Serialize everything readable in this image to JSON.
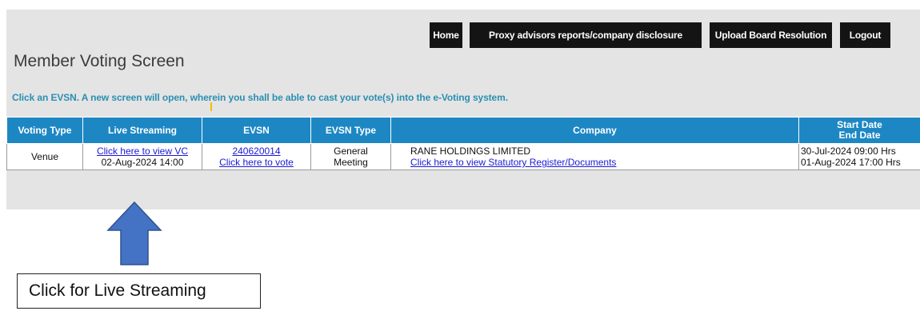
{
  "nav": {
    "home": "Home",
    "proxy": "Proxy advisors reports/company disclosure",
    "upload": "Upload Board Resolution",
    "logout": "Logout"
  },
  "page": {
    "title": "Member Voting Screen",
    "instruction": "Click an EVSN. A new screen will open, wherein you shall be able to cast your vote(s) into the e-Voting system."
  },
  "table": {
    "headers": {
      "voting_type": "Voting Type",
      "live_streaming": "Live Streaming",
      "evsn": "EVSN",
      "evsn_type": "EVSN Type",
      "company": "Company",
      "start_date": "Start Date",
      "end_date": "End Date"
    },
    "rows": [
      {
        "voting_type": "Venue",
        "live_link": "Click here to view VC",
        "live_datetime": "02-Aug-2024 14:00",
        "evsn": "240620014",
        "vote_link": "Click here to vote",
        "evsn_type_1": "General",
        "evsn_type_2": "Meeting",
        "company_name": "RANE HOLDINGS LIMITED",
        "company_link": "Click here to view Statutory Register/Documents",
        "start": "30-Jul-2024 09:00 Hrs",
        "end": "01-Aug-2024 17:00 Hrs"
      }
    ]
  },
  "annotation": {
    "callout": "Click for Live Streaming",
    "arrow_color": "#4472c4"
  },
  "colors": {
    "header_bg": "#1d87c4",
    "nav_bg": "#141414",
    "instruction": "#2a8fb3",
    "link": "#1a1ad6"
  }
}
